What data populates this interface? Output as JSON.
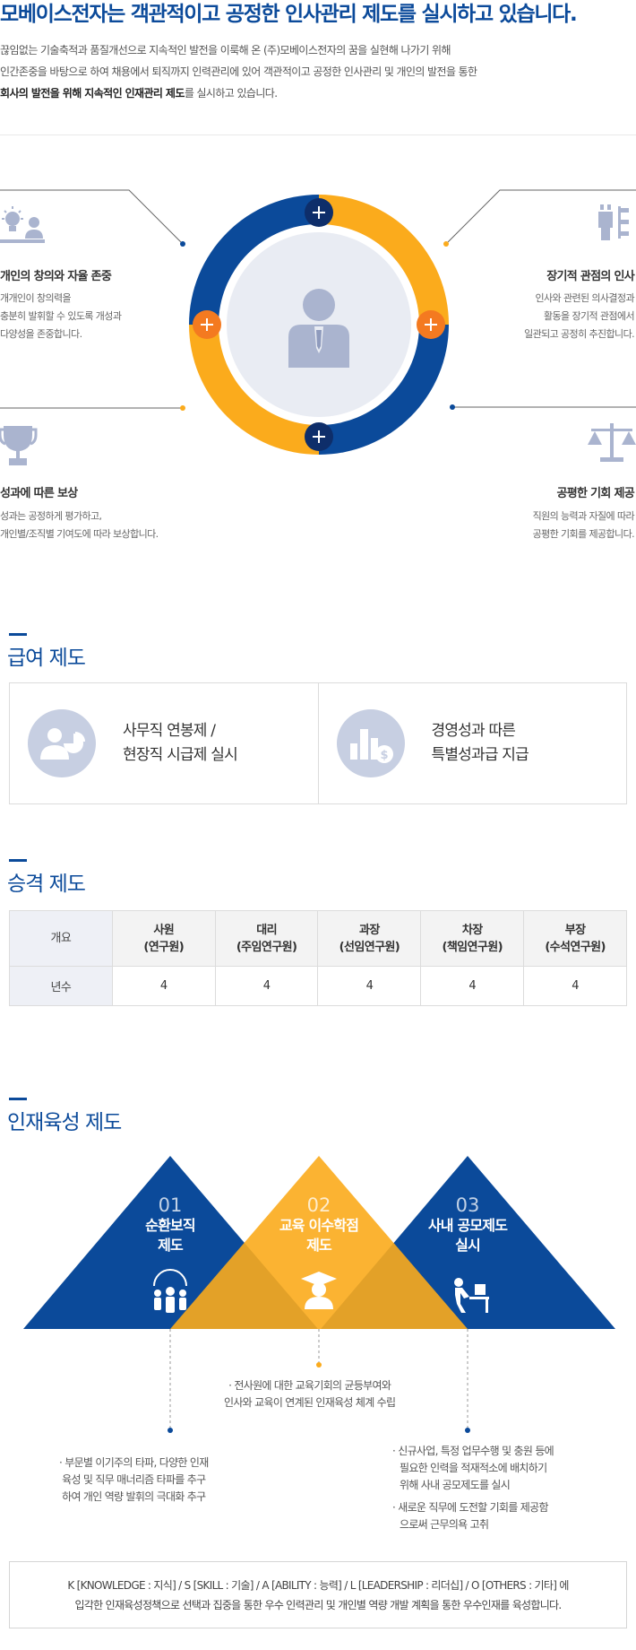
{
  "header": {
    "headline": "모베이스전자는 객관적이고 공정한 인사관리 제도를 실시하고 있습니다.",
    "intro_line1": "끊임없는 기술축적과 품질개선으로 지속적인 발전을 이룩해 온 (주)모베이스전자의 꿈을 실현해 나가기 위해",
    "intro_line2": "인간존중을 바탕으로 하여 채용에서 퇴직까지 인력관리에 있어 객관적이고 공정한 인사관리 및 개인의 발전을 통한",
    "intro_line3_bold": "회사의 발전을 위해 지속적인 인재관리 제도",
    "intro_line3_rest": "를 실시하고 있습니다."
  },
  "values": {
    "top_left": {
      "title": "개인의 창의와 자율 존중",
      "desc1": "개개인이 창의력을",
      "desc2": "충분히 발휘할 수 있도록 개성과",
      "desc3": "다양성을 존중합니다."
    },
    "top_right": {
      "title": "장기적 관점의 인사",
      "desc1": "인사와 관련된 의사결정과",
      "desc2": "활동을 장기적 관점에서",
      "desc3": "일관되고 공정히 추진합니다."
    },
    "bottom_left": {
      "title": "성과에 따른 보상",
      "desc1": "성과는 공정하게 평가하고,",
      "desc2": "개인별/조직별 기여도에 따라 보상합니다."
    },
    "bottom_right": {
      "title": "공평한 기회 제공",
      "desc1": "직원의 능력과 자질에 따라",
      "desc2": "공평한 기회를 제공합니다."
    }
  },
  "salary": {
    "section_title": "급여 제도",
    "item1_line1": "사무직 연봉제 /",
    "item1_line2": "현장직 시급제 실시",
    "item2_line1": "경영성과 따른",
    "item2_line2": "특별성과급 지급"
  },
  "promotion": {
    "section_title": "승격 제도",
    "corner": "개요",
    "row_label": "년수",
    "columns": [
      {
        "title": "사원",
        "sub": "(연구원)",
        "years": "4"
      },
      {
        "title": "대리",
        "sub": "(주임연구원)",
        "years": "4"
      },
      {
        "title": "과장",
        "sub": "(선임연구원)",
        "years": "4"
      },
      {
        "title": "차장",
        "sub": "(책임연구원)",
        "years": "4"
      },
      {
        "title": "부장",
        "sub": "(수석연구원)",
        "years": "4"
      }
    ]
  },
  "development": {
    "section_title": "인재육성 제도",
    "items": [
      {
        "num": "01",
        "name1": "순환보직",
        "name2": "제도"
      },
      {
        "num": "02",
        "name1": "교육 이수학점",
        "name2": "제도"
      },
      {
        "num": "03",
        "name1": "사내 공모제도",
        "name2": "실시"
      }
    ],
    "desc_center1": "· 전사원에 대한 교육기회의 균등부여와",
    "desc_center2": "인사와 교육이 연계된 인재육성 체계 수립",
    "desc_left1": "· 부문별 이기주의 타파, 다양한 인재",
    "desc_left2": "육성 및 직무 매너리즘 타파를 추구",
    "desc_left3": "하여 개인 역량 발휘의 극대화  추구",
    "desc_right1": "· 신규사업, 특정 업무수행 및 충원 등에",
    "desc_right2": "필요한 인력을 적재적소에 배치하기",
    "desc_right3": "위해 사내 공모제도를 실시",
    "desc_right4": "· 새로운 직무에 도전할 기회를 제공함",
    "desc_right5": "으로써 근무의욕 고취"
  },
  "footer": {
    "line1": "K [KNOWLEDGE : 지식]  / S [SKILL : 기술]  / A [ABILITY : 능력]  / L [LEADERSHIP : 리더십]  / O  [OTHERS : 기타] 에",
    "line2": "입각한 인재육성정책으로 선택과 집중을 통한 우수 인력관리 및 개인별 역량 개발 계획을 통한 우수인재를 육성합니다."
  },
  "colors": {
    "brand_blue": "#0b4a9a",
    "accent_orange": "#fbab1c",
    "plus_orange": "#f47a20",
    "icon_gray": "#aab4cf"
  }
}
